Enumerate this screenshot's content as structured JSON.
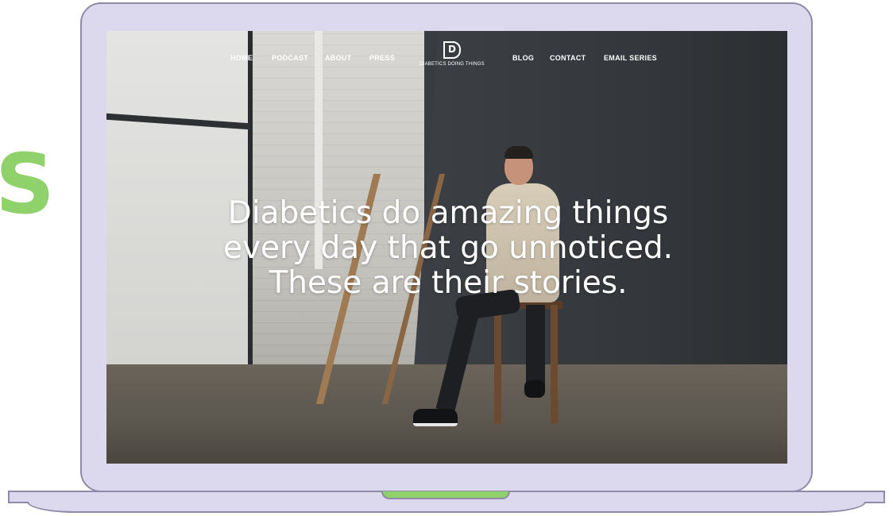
{
  "background": {
    "accent_letter": "S",
    "accent_color": "#8fd16a",
    "device_color": "#dcd8ee"
  },
  "nav": {
    "left_items": [
      "HOME",
      "PODCAST",
      "ABOUT",
      "PRESS"
    ],
    "right_items": [
      "BLOG",
      "CONTACT",
      "EMAIL SERIES"
    ]
  },
  "logo": {
    "mark": "D",
    "text": "DIABETICS DOING THINGS"
  },
  "hero": {
    "lines": [
      "Diabetics do amazing things",
      "every day that go unnoticed.",
      "These are their stories."
    ]
  }
}
